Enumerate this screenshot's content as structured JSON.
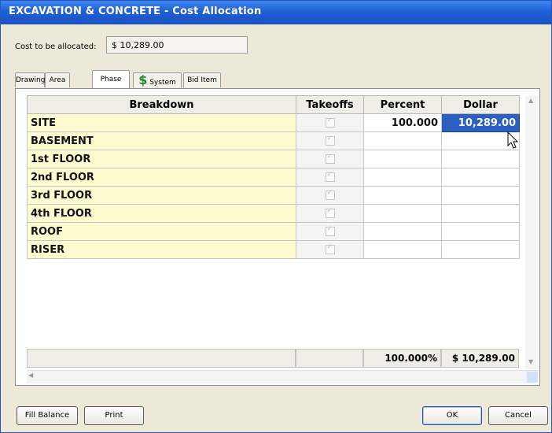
{
  "window": {
    "title": "EXCAVATION & CONCRETE - Cost Allocation"
  },
  "cost": {
    "label": "Cost to be allocated:",
    "value": "$ 10,289.00"
  },
  "tabs": [
    {
      "label": "Drawing"
    },
    {
      "label": "Area"
    },
    {
      "label": "Phase"
    },
    {
      "label": "System"
    },
    {
      "label": "Bid Item"
    }
  ],
  "tab_icon": {
    "glyph": "$",
    "icon": "dollar-icon",
    "color": "#1c8b2c"
  },
  "grid": {
    "headers": {
      "breakdown": "Breakdown",
      "takeoffs": "Takeoffs",
      "percent": "Percent",
      "dollar": "Dollar"
    },
    "rows": [
      {
        "name": "SITE",
        "percent": "100.000",
        "dollar": "10,289.00"
      },
      {
        "name": "BASEMENT",
        "percent": "",
        "dollar": ""
      },
      {
        "name": "1st FLOOR",
        "percent": "",
        "dollar": ""
      },
      {
        "name": "2nd FLOOR",
        "percent": "",
        "dollar": ""
      },
      {
        "name": "3rd FLOOR",
        "percent": "",
        "dollar": ""
      },
      {
        "name": "4th FLOOR",
        "percent": "",
        "dollar": ""
      },
      {
        "name": "ROOF",
        "percent": "",
        "dollar": ""
      },
      {
        "name": "RISER",
        "percent": "",
        "dollar": ""
      }
    ],
    "totals": {
      "percent": "100.000%",
      "dollar": "$ 10,289.00"
    }
  },
  "buttons": {
    "fill_balance": "Fill Balance",
    "print": "Print",
    "ok": "OK",
    "cancel": "Cancel"
  },
  "colors": {
    "title_bar": "#1f5fd4",
    "name_cell": "#fffbd0",
    "selected_cell": "#2b5fc1"
  }
}
